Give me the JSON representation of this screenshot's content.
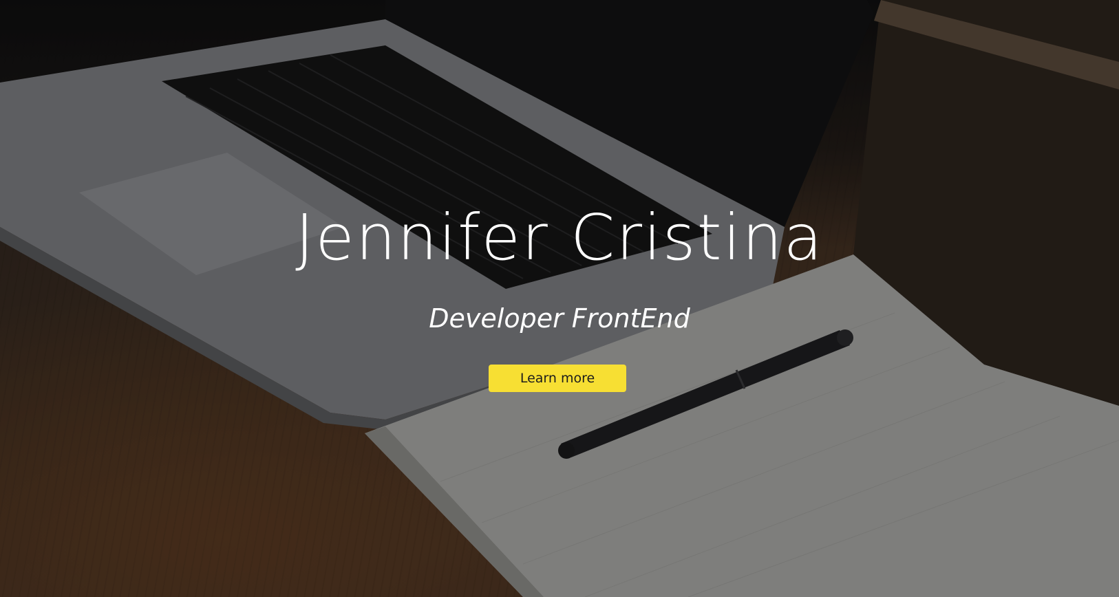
{
  "hero": {
    "name": "Jennifer Cristina",
    "role": "Developer FrontEnd",
    "cta_label": "Learn more",
    "background": "laptop-notebook-pen-desk-photo"
  },
  "colors": {
    "accent": "#f7df33",
    "heading": "#ffffff",
    "button_text": "#1c1c1c"
  }
}
